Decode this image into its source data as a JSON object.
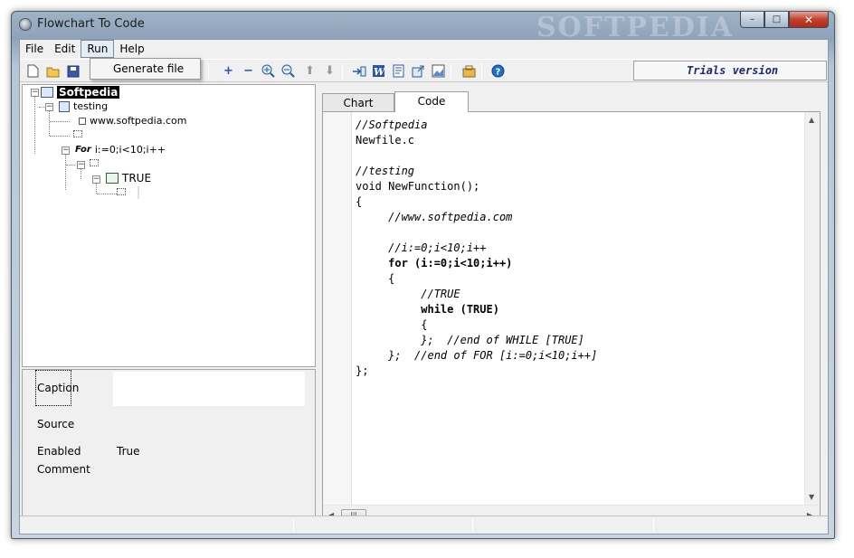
{
  "window": {
    "title": "Flowchart To Code",
    "watermark": "SOFTPEDIA",
    "controls": {
      "minimize": "–",
      "maximize": "□",
      "close": "✕"
    }
  },
  "menu": {
    "items": [
      "File",
      "Edit",
      "Run",
      "Help"
    ],
    "active": "Run",
    "dropdown": {
      "items": [
        "Generate file"
      ]
    }
  },
  "toolbar": {
    "trial_text": "Trials version",
    "icons": [
      "new-file-icon",
      "open-folder-icon",
      "save-icon",
      "add-icon",
      "remove-icon",
      "zoom-in-icon",
      "zoom-out-icon",
      "move-up-icon",
      "move-down-icon",
      "insert-icon",
      "word-export-icon",
      "document-icon",
      "export-icon",
      "image-icon",
      "tools-icon",
      "help-icon"
    ]
  },
  "tree": {
    "nodes": [
      {
        "label": "Softpedia",
        "level": 0,
        "selected": true
      },
      {
        "label": "testing",
        "level": 1
      },
      {
        "label": "www.softpedia.com",
        "level": 2
      },
      {
        "label": "",
        "level": 2
      },
      {
        "label": "i:=0;i<10;i++",
        "prefix": "For",
        "level": 1
      },
      {
        "label": "",
        "level": 2
      },
      {
        "label": "TRUE",
        "level": 3
      },
      {
        "label": "",
        "level": 4
      }
    ]
  },
  "properties": {
    "rows": [
      {
        "label": "Caption",
        "value": ""
      },
      {
        "label": "Source",
        "value": ""
      },
      {
        "label": "Enabled",
        "value": "True"
      },
      {
        "label": "Comment",
        "value": ""
      }
    ]
  },
  "tabs": {
    "items": [
      "Chart",
      "Code"
    ],
    "active": "Code"
  },
  "code": {
    "lines": [
      "//Softpedia",
      "Newfile.c",
      "",
      "//testing",
      "void NewFunction();",
      "{",
      "     //www.softpedia.com",
      "",
      "     //i:=0;i<10;i++",
      "     for (i:=0;i<10;i++)",
      "     {",
      "          //TRUE",
      "          while (TRUE)",
      "          {",
      "          };  //end of WHILE [TRUE]",
      "     };  //end of FOR [i:=0;i<10;i++]",
      "};"
    ]
  },
  "scroll": {
    "thumb_grip": "III"
  }
}
